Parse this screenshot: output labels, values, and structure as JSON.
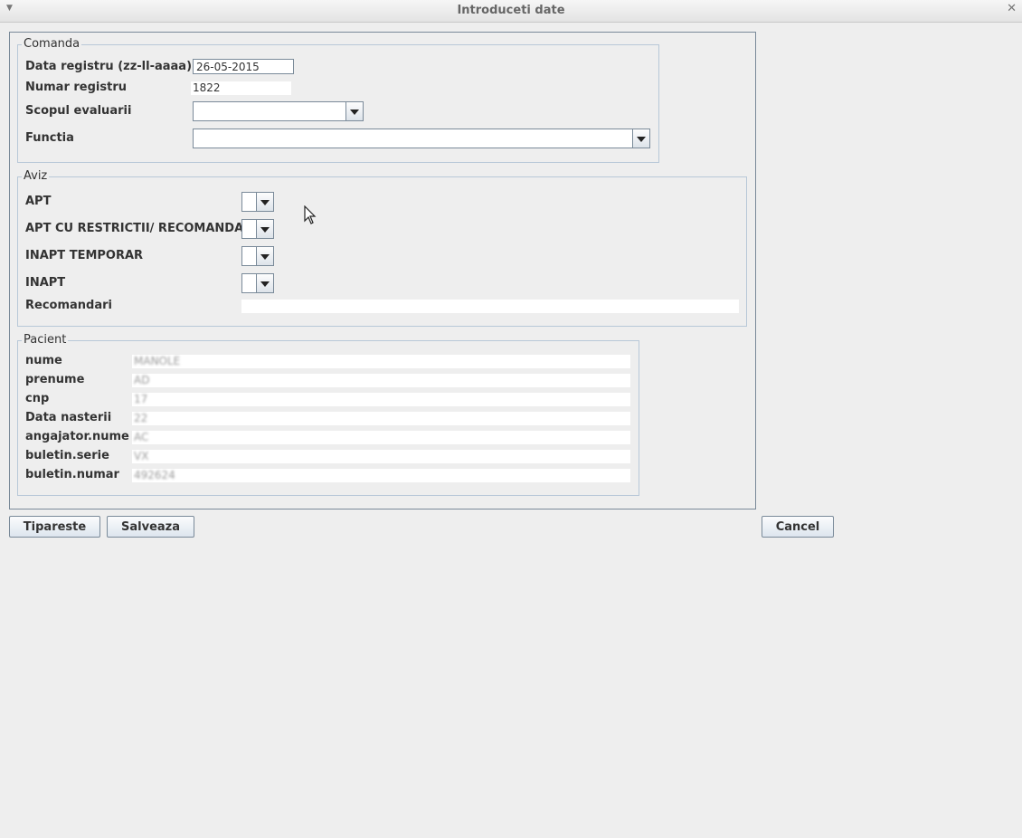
{
  "window": {
    "title": "Introduceti date"
  },
  "comanda": {
    "legend": "Comanda",
    "data_registru_label": "Data registru (zz-ll-aaaa)",
    "data_registru_value": "26-05-2015",
    "numar_registru_label": "Numar registru",
    "numar_registru_value": "1822",
    "scopul_label": "Scopul evaluarii",
    "scopul_value": "",
    "functia_label": "Functia",
    "functia_value": ""
  },
  "aviz": {
    "legend": "Aviz",
    "apt_label": "APT",
    "apt_restrictii_label": "APT CU RESTRICTII/ RECOMANDARI",
    "inapt_temporar_label": "INAPT TEMPORAR",
    "inapt_label": "INAPT",
    "recomandari_label": "Recomandari",
    "recomandari_value": ""
  },
  "pacient": {
    "legend": "Pacient",
    "fields": [
      {
        "label": "nume",
        "value": "MANOLE"
      },
      {
        "label": "prenume",
        "value": "AD"
      },
      {
        "label": "cnp",
        "value": "17"
      },
      {
        "label": "Data nasterii",
        "value": "22"
      },
      {
        "label": "angajator.nume",
        "value": "AC"
      },
      {
        "label": "buletin.serie",
        "value": "VX"
      },
      {
        "label": "buletin.numar",
        "value": "492624"
      }
    ]
  },
  "buttons": {
    "tipareste": "Tipareste",
    "salveaza": "Salveaza",
    "cancel": "Cancel"
  }
}
